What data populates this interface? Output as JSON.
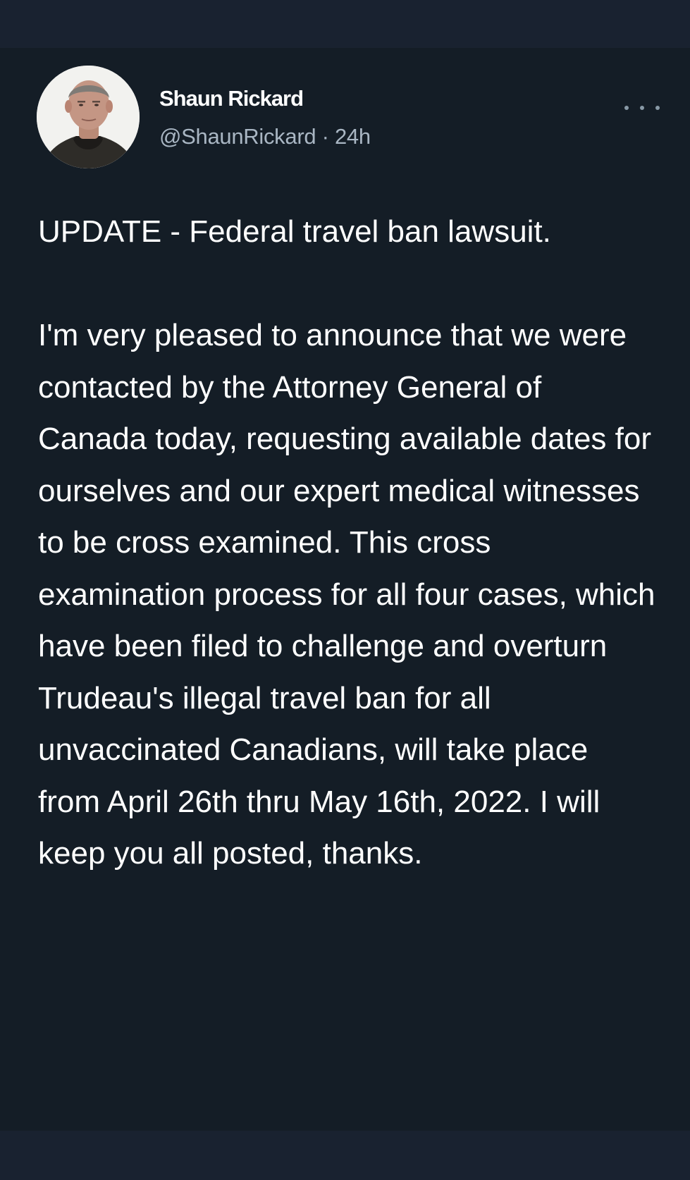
{
  "tweet": {
    "author": {
      "name": "Shaun Rickard",
      "handle": "@ShaunRickard",
      "avatar_icon": "profile-photo"
    },
    "time": "24h",
    "meta_separator": "·",
    "more_icon": "more-options-icon",
    "text": "UPDATE - Federal travel ban lawsuit.\n\nI'm very pleased to announce that we were contacted by the Attorney General of Canada today, requesting available dates for ourselves and our expert medical witnesses to be cross examined. This cross examination process for all four cases, which have been filed to challenge and overturn Trudeau's illegal travel ban for all unvaccinated Canadians, will take place from April 26th thru May 16th, 2022. I will keep you all posted, thanks."
  },
  "colors": {
    "background": "#141d26",
    "bars": "#192230",
    "text": "#ffffff",
    "secondary_text": "#a9b6c3"
  }
}
